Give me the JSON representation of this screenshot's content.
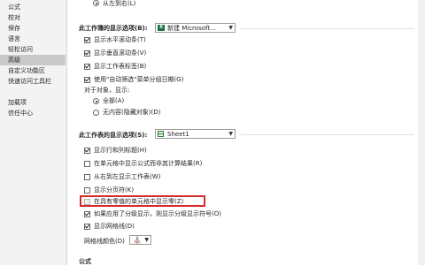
{
  "nav": {
    "items": [
      {
        "label": "公式"
      },
      {
        "label": "校对"
      },
      {
        "label": "保存"
      },
      {
        "label": "语言"
      },
      {
        "label": "轻松访问"
      },
      {
        "label": "高级"
      },
      {
        "label": "自定义功能区"
      },
      {
        "label": "快速访问工具栏"
      },
      {
        "label": "加载项"
      },
      {
        "label": "信任中心"
      }
    ],
    "active_index": 5
  },
  "top": {
    "right_to_left_label": "从左到右(L)"
  },
  "workbook_section": {
    "title": "此工作簿的显示选项(B):",
    "combo_value": "新建 Microsoft...",
    "options": [
      {
        "label": "显示水平滚动条(T)",
        "checked": true
      },
      {
        "label": "显示垂直滚动条(V)",
        "checked": true
      },
      {
        "label": "显示工作表标签(B)",
        "checked": true
      },
      {
        "label": "使用\"自动筛选\"菜单分组日期(G)",
        "checked": true
      }
    ],
    "objects_label": "对于对象，显示:",
    "radio_all": "全部(A)",
    "radio_none": "无内容(隐藏对象)(D)"
  },
  "sheet_section": {
    "title": "此工作表的显示选项(S):",
    "combo_value": "Sheet1",
    "options": [
      {
        "label": "显示行和列标题(H)",
        "checked": true,
        "disabled": false
      },
      {
        "label": "在单元格中显示公式而非其计算结果(R)",
        "checked": false,
        "disabled": false
      },
      {
        "label": "从右到左显示工作表(W)",
        "checked": false,
        "disabled": false
      },
      {
        "label": "显示分页符(K)",
        "checked": false,
        "disabled": false
      },
      {
        "label": "在具有零值的单元格中显示零(Z)",
        "checked": false,
        "disabled": true
      },
      {
        "label": "如果应用了分级显示，则显示分级显示符号(O)",
        "checked": true,
        "disabled": false
      },
      {
        "label": "显示网格线(D)",
        "checked": true,
        "disabled": false
      }
    ],
    "gridline_color_label": "网格线颜色(D)"
  },
  "next_section": {
    "title": "公式"
  }
}
